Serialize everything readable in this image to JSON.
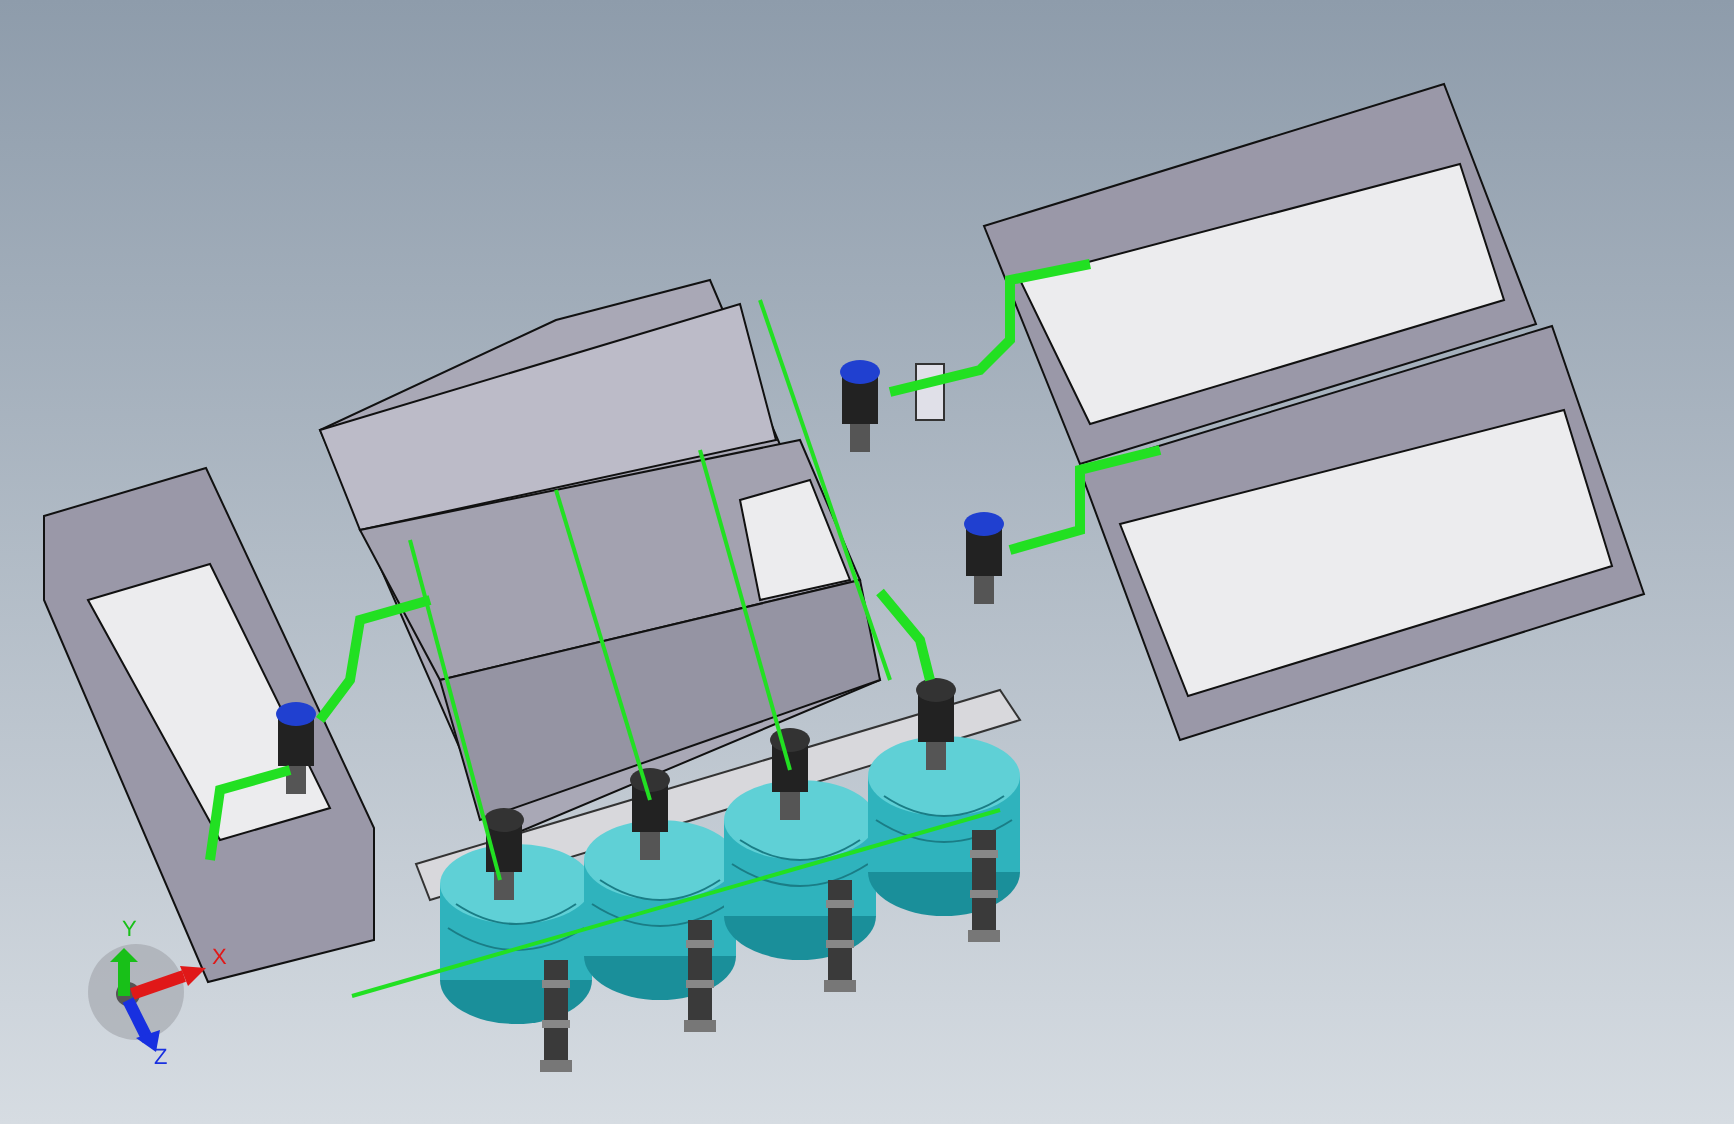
{
  "triad": {
    "axes": [
      {
        "label": "X",
        "color": "#e01818"
      },
      {
        "label": "Y",
        "color": "#18c018"
      },
      {
        "label": "Z",
        "color": "#1830e0"
      }
    ]
  }
}
